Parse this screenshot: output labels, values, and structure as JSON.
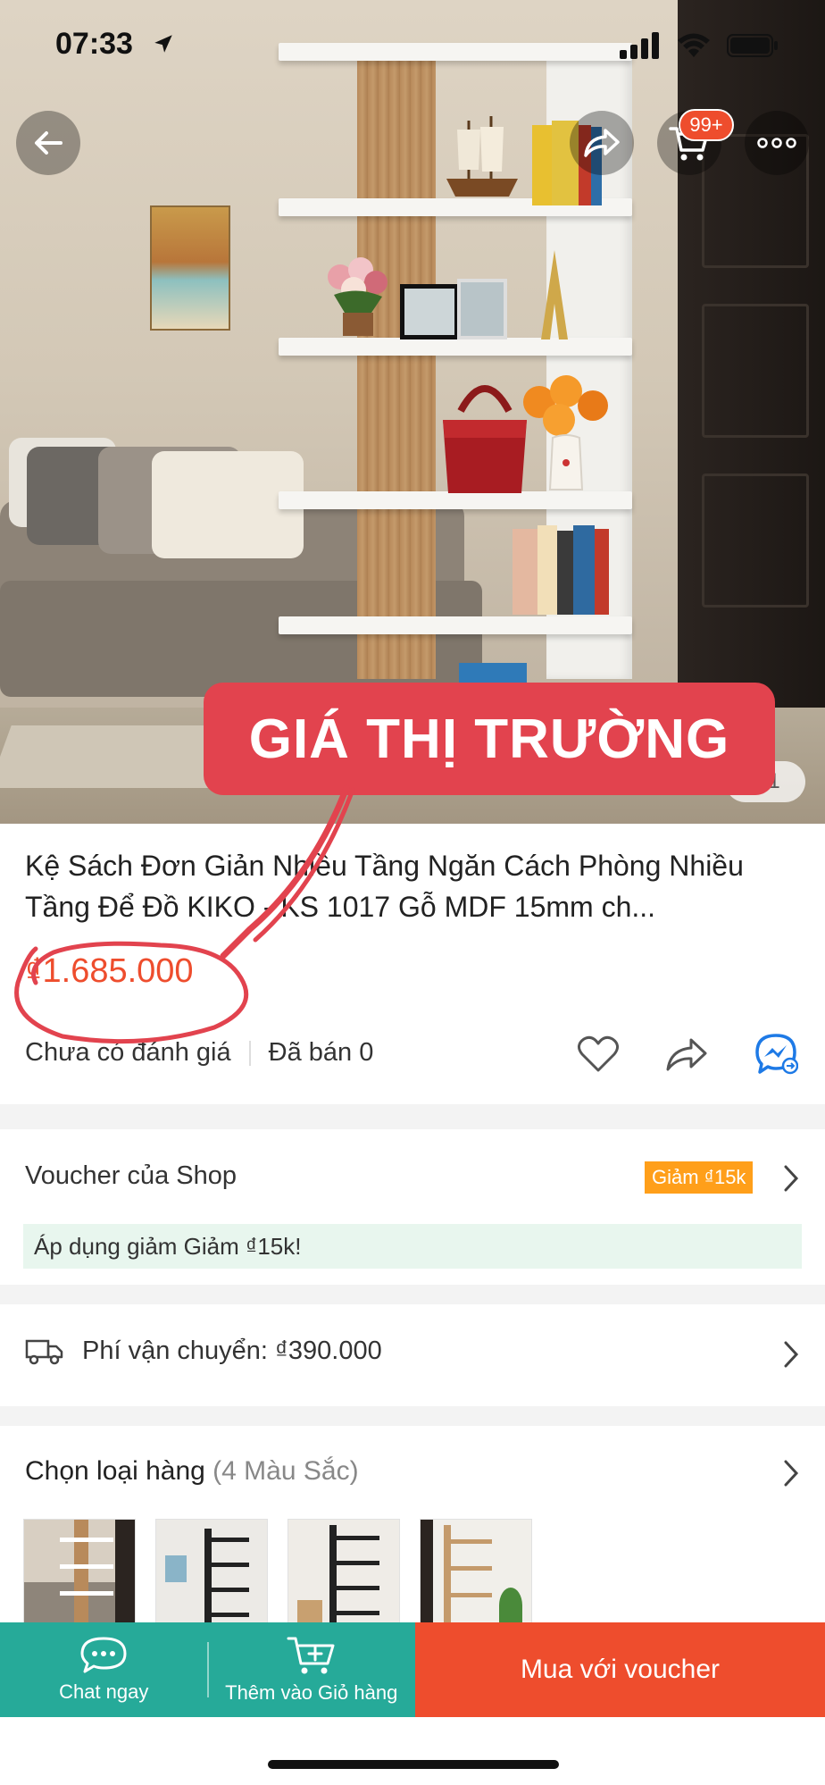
{
  "status_bar": {
    "time": "07:33"
  },
  "hero": {
    "image_counter": "1/1",
    "cart_badge": "99+"
  },
  "annotation": {
    "label": "GIÁ THỊ TRƯỜNG"
  },
  "product": {
    "title": "Kệ Sách  Đơn Giản Nhiều Tầng Ngăn Cách Phòng Nhiều Tầng Để Đồ KIKO - KS 1017 Gỗ MDF 15mm ch...",
    "price": "₫1.685.000",
    "rating_text": "Chưa có đánh giá",
    "sold_text": "Đã bán 0"
  },
  "voucher": {
    "label": "Voucher của Shop",
    "tag": "Giảm ₫15k",
    "note": "Áp dụng giảm Giảm ₫15k!"
  },
  "shipping": {
    "label": "Phí vận chuyển: ₫390.000"
  },
  "variants": {
    "title": "Chọn loại hàng",
    "count": "(4 Màu Sắc)"
  },
  "bottom_bar": {
    "chat_label": "Chat ngay",
    "add_cart_label": "Thêm vào Giỏ hàng",
    "buy_label": "Mua với voucher"
  },
  "colors": {
    "brand": "#ee4d2d",
    "teal": "#26aa99",
    "voucher_tag": "#ff9f1a",
    "annotation": "#e2434e"
  }
}
